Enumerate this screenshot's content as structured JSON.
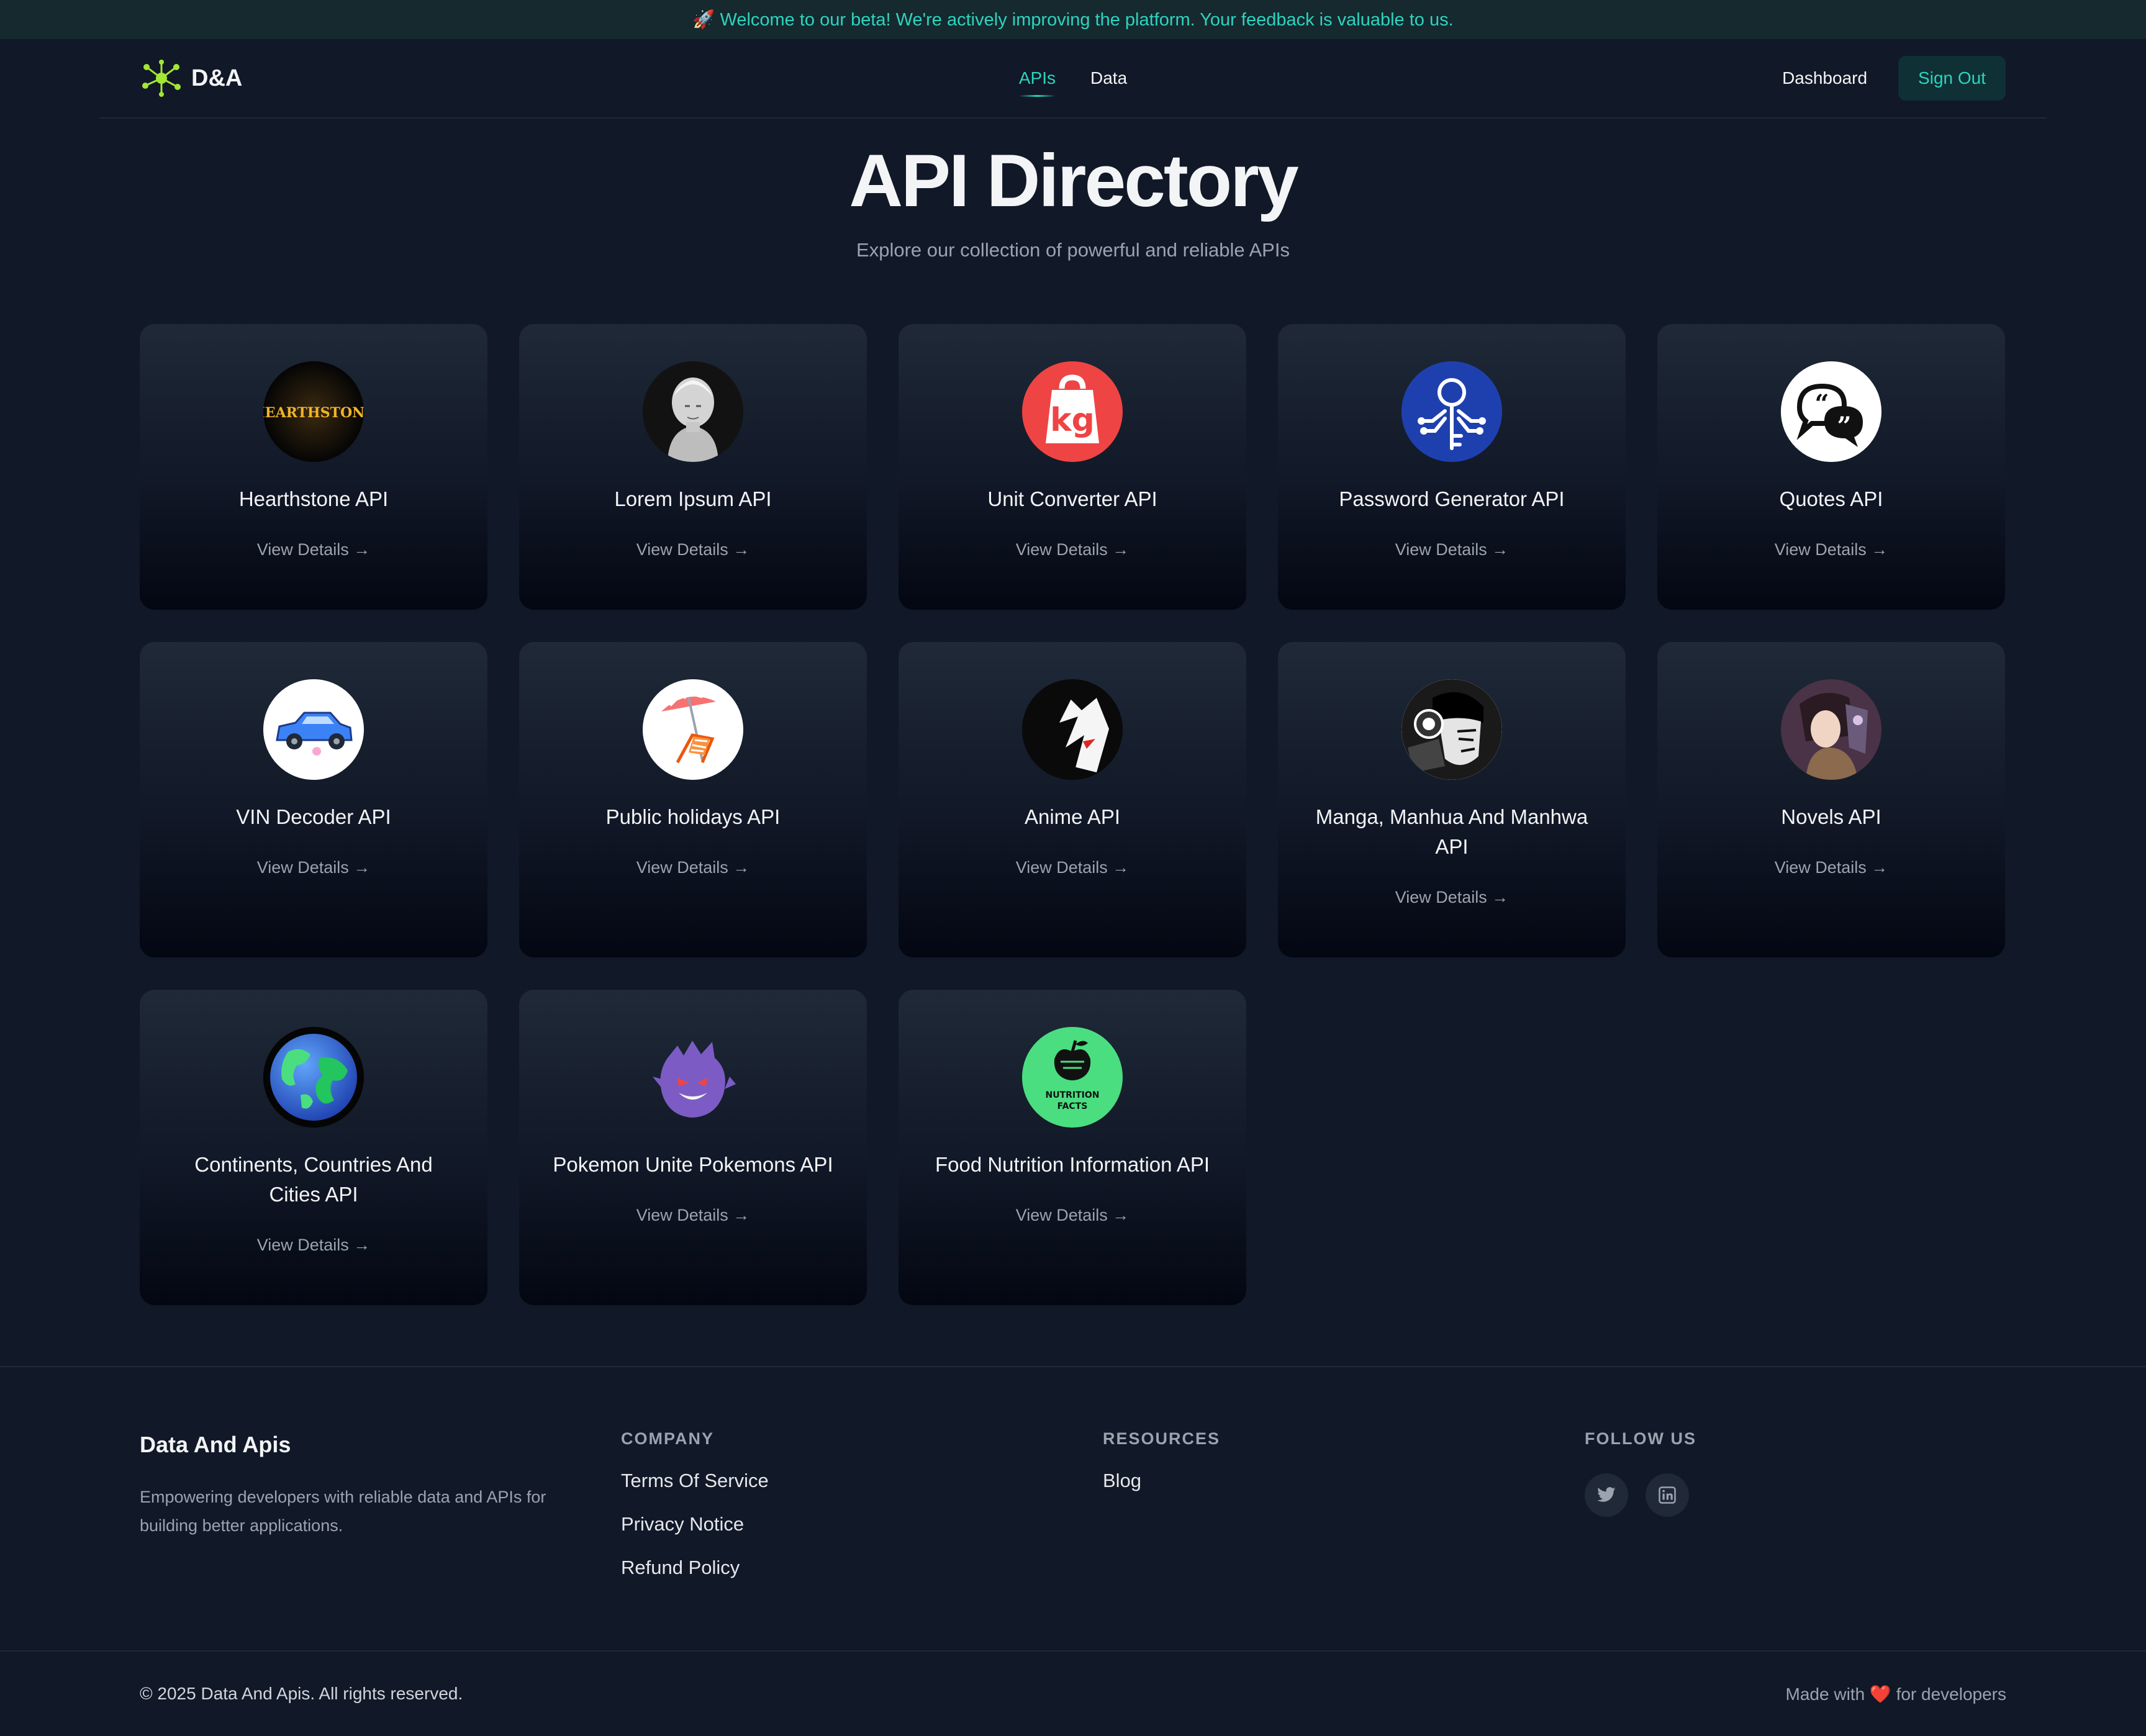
{
  "banner": {
    "icon": "rocket-icon",
    "text": "🚀 Welcome to our beta! We're actively improving the platform. Your feedback is valuable to us."
  },
  "nav": {
    "logo_text": "D&A",
    "links": [
      "APIs",
      "Data"
    ],
    "dashboard": "Dashboard",
    "sign_out": "Sign Out"
  },
  "hero": {
    "title": "API Directory",
    "subtitle": "Explore our collection of powerful and reliable APIs"
  },
  "view_details": "View Details →",
  "cards": [
    {
      "title": "Hearthstone API",
      "icon": "hearthstone-logo",
      "logo_text": "HEARTHSTONE"
    },
    {
      "title": "Lorem Ipsum API",
      "icon": "bust-statue"
    },
    {
      "title": "Unit Converter API",
      "icon": "kg-weight",
      "logo_text": "kg"
    },
    {
      "title": "Password Generator API",
      "icon": "circuit-key"
    },
    {
      "title": "Quotes API",
      "icon": "quote-bubbles"
    },
    {
      "title": "VIN Decoder API",
      "icon": "blue-car"
    },
    {
      "title": "Public holidays API",
      "icon": "beach-chair"
    },
    {
      "title": "Anime API",
      "icon": "anime-face"
    },
    {
      "title": "Manga, Manhua And Manhwa API",
      "icon": "manga-face"
    },
    {
      "title": "Novels API",
      "icon": "novel-character"
    },
    {
      "title": "Continents, Countries And Cities API",
      "icon": "globe"
    },
    {
      "title": "Pokemon Unite Pokemons API",
      "icon": "gengar"
    },
    {
      "title": "Food Nutrition Information API",
      "icon": "nutrition-facts",
      "logo_text": "NUTRITION FACTS"
    }
  ],
  "footer": {
    "brand": "Data And Apis",
    "description": "Empowering developers with reliable data and APIs for building better applications.",
    "company_heading": "COMPANY",
    "company_links": [
      "Terms Of Service",
      "Privacy Notice",
      "Refund Policy"
    ],
    "resources_heading": "RESOURCES",
    "resources_links": [
      "Blog"
    ],
    "follow_heading": "FOLLOW US",
    "social": [
      "twitter-icon",
      "linkedin-icon"
    ],
    "copyright": "© 2025 Data And Apis. All rights reserved.",
    "made_with": "Made with ❤️ for developers"
  },
  "colors": {
    "accent": "#2dd4bf",
    "background": "#111827",
    "logo_green": "#a3e635"
  }
}
